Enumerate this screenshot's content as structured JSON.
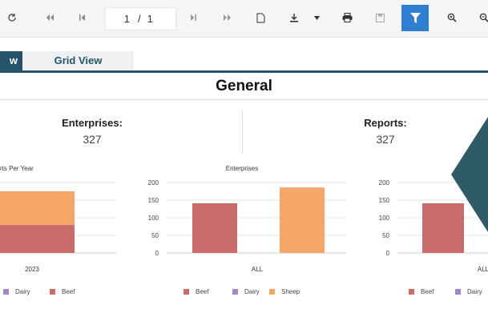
{
  "toolbar": {
    "page_current": "1",
    "page_separator": "/",
    "page_total": "1",
    "icons": [
      "refresh-icon",
      "first-page-icon",
      "previous-page-icon",
      "next-page-icon",
      "last-page-icon",
      "document-icon",
      "download-icon",
      "print-icon",
      "save-icon",
      "filter-icon",
      "zoom-in-icon",
      "zoom-out-icon"
    ]
  },
  "tabs": {
    "active_label": "w",
    "grid_label": "Grid View"
  },
  "section": {
    "title": "General"
  },
  "stats": {
    "enterprises_label": "Enterprises:",
    "enterprises_value": "327",
    "reports_label": "Reports:",
    "reports_value": "327"
  },
  "colors": {
    "beef": "#c96b6b",
    "dairy": "#a487c4",
    "sheep": "#f5a76a",
    "accent": "#25546a",
    "arrow": "#2e5b67"
  },
  "chart_data": [
    {
      "type": "bar",
      "stacked": true,
      "title": "rts Per Year",
      "categories": [
        "2023"
      ],
      "series": [
        {
          "name": "Beef",
          "values": [
            80
          ]
        },
        {
          "name": "Sheep",
          "values": [
            95
          ]
        }
      ],
      "legend": [
        "Dairy",
        "Beef"
      ],
      "ylim": [
        0,
        200
      ]
    },
    {
      "type": "bar",
      "title": "Enterprises",
      "categories": [
        "ALL"
      ],
      "yticks": [
        "200",
        "150",
        "100",
        "50",
        "0"
      ],
      "series": [
        {
          "name": "Beef",
          "values": [
            141
          ]
        },
        {
          "name": "Dairy",
          "values": [
            0
          ]
        },
        {
          "name": "Sheep",
          "values": [
            186
          ]
        }
      ],
      "legend": [
        "Beef",
        "Dairy",
        "Sheep"
      ],
      "ylim": [
        0,
        200
      ]
    },
    {
      "type": "bar",
      "title": "",
      "categories": [
        "ALL"
      ],
      "yticks": [
        "200",
        "150",
        "100",
        "50",
        "0"
      ],
      "series": [
        {
          "name": "Beef",
          "values": [
            141
          ]
        }
      ],
      "legend": [
        "Beef",
        "Dairy"
      ],
      "ylim": [
        0,
        200
      ]
    }
  ]
}
